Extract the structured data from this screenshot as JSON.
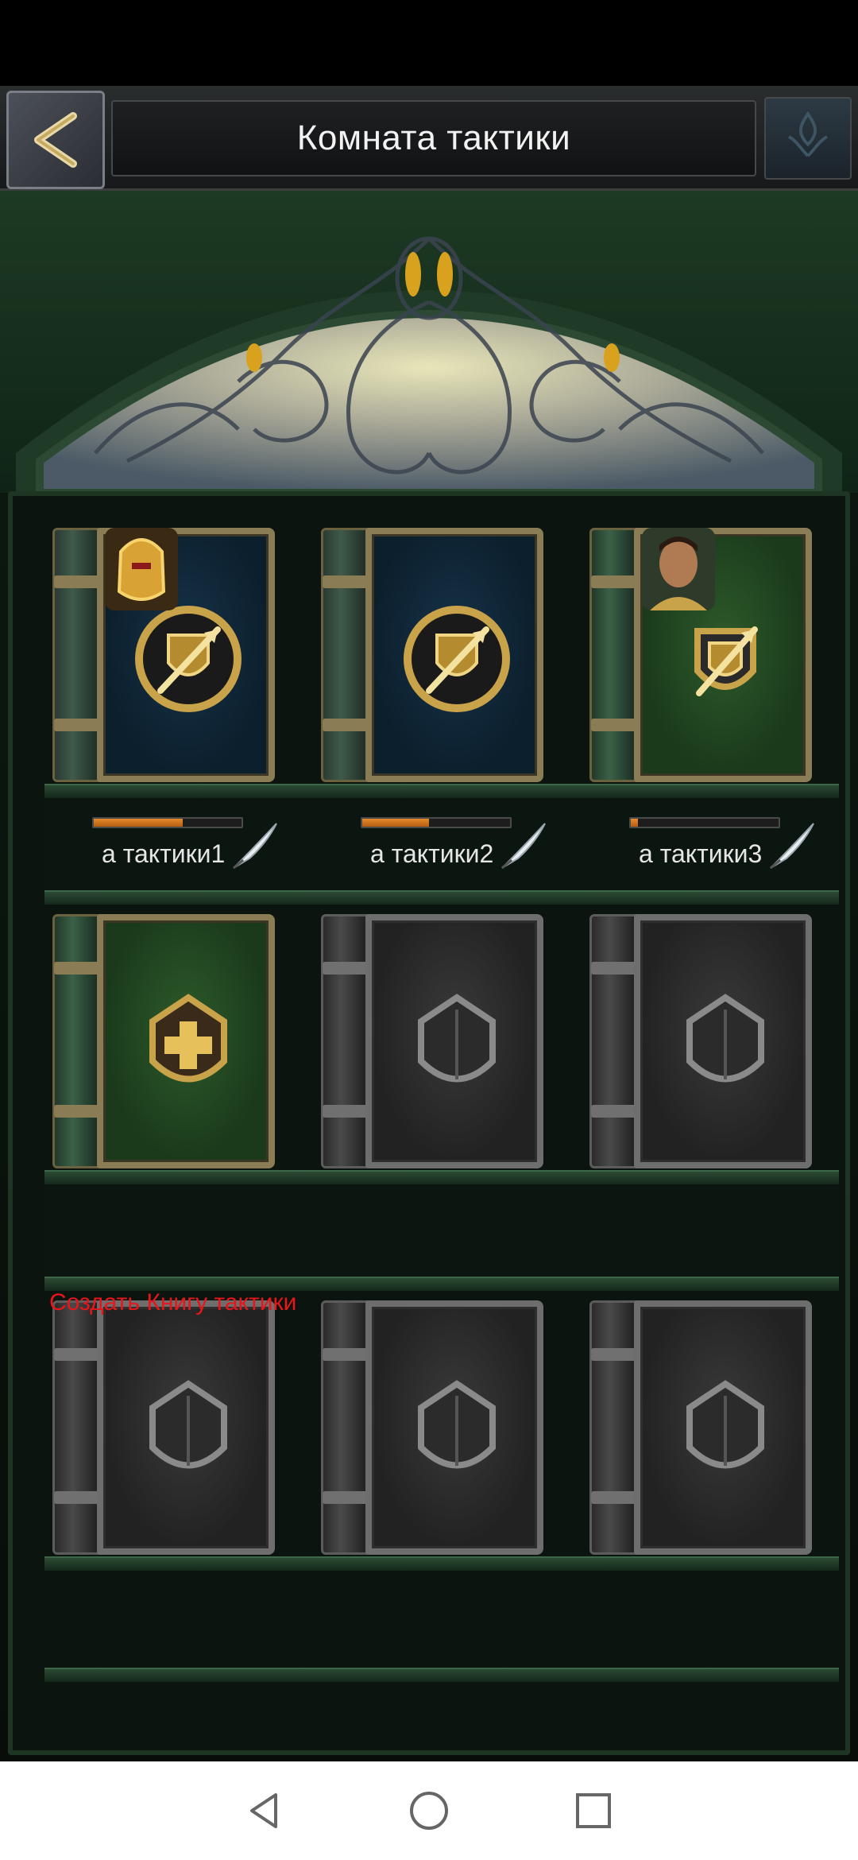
{
  "header": {
    "title": "Комната тактики"
  },
  "books_row1": [
    {
      "label": "а тактики1",
      "progress": 0.6,
      "color": "blue",
      "portrait": "golden-knight"
    },
    {
      "label": "а тактики2",
      "progress": 0.45,
      "color": "blue",
      "portrait": null
    },
    {
      "label": "а тактики3",
      "progress": 0.05,
      "color": "green",
      "portrait": "hero-man"
    }
  ],
  "create_book_text": "Создать Книгу тактики",
  "colors": {
    "accent_red": "#e8161a",
    "progress_orange": "#e58a2b",
    "title_text": "#f2f2f2"
  },
  "icons": {
    "back": "back-arrow-icon",
    "tactics_emblem": "spear-shield-icon",
    "add": "plus-shield-icon",
    "quill": "quill-icon",
    "nav_back": "triangle-back-icon",
    "nav_home": "circle-home-icon",
    "nav_recent": "square-recent-icon"
  }
}
